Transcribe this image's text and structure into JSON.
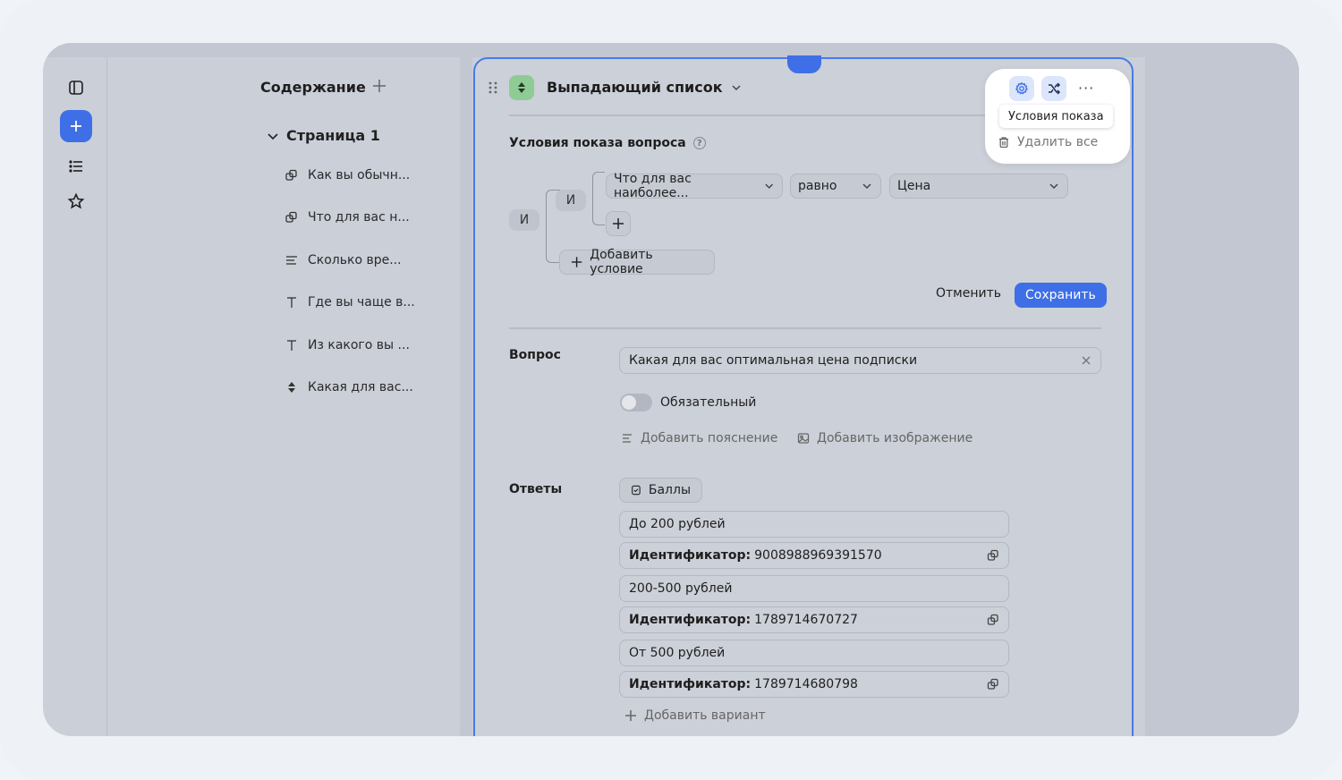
{
  "toc": {
    "title": "Содержание",
    "page": "Страница 1",
    "items": [
      {
        "label": "Как вы обычн...",
        "icon": "copy-icon"
      },
      {
        "label": "Что для вас н...",
        "icon": "copy-icon"
      },
      {
        "label": "Сколько вре...",
        "icon": "text-lines-icon"
      },
      {
        "label": "Где вы чаще в...",
        "icon": "text-t-icon"
      },
      {
        "label": "Из какого вы ...",
        "icon": "text-t-icon"
      },
      {
        "label": "Какая для вас...",
        "icon": "dropdown-icon"
      }
    ]
  },
  "editor": {
    "title": "Выпадающий список",
    "conditions": {
      "label": "Условия показа вопроса",
      "outer_op": "И",
      "inner_op": "И",
      "question": "Что для вас наиболее...",
      "operator": "равно",
      "value": "Цена",
      "add_condition": "Добавить условие",
      "cancel": "Отменить",
      "save": "Сохранить"
    },
    "question": {
      "label": "Вопрос",
      "value": "Какая для вас оптимальная цена подписки",
      "required": "Обязательный",
      "add_hint": "Добавить пояснение",
      "add_image": "Добавить изображение"
    },
    "answers": {
      "label": "Ответы",
      "scores": "Баллы",
      "id_label": "Идентификатор:",
      "options": [
        {
          "text": "До 200 рублей",
          "id": "9008988969391570"
        },
        {
          "text": "200-500 рублей",
          "id": "1789714670727"
        },
        {
          "text": "От 500 рублей",
          "id": "1789714680798"
        }
      ],
      "add_option": "Добавить вариант"
    }
  },
  "popover": {
    "tooltip": "Условия показа",
    "delete_all": "Удалить все"
  },
  "colors": {
    "accent": "#3f6fe6",
    "badge": "#8fcb95"
  }
}
